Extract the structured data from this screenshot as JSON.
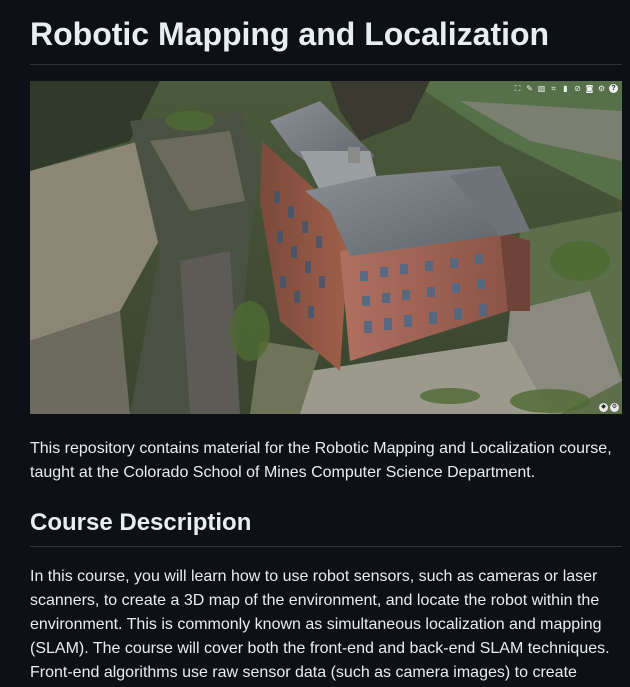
{
  "title": "Robotic Mapping and Localization",
  "viewer": {
    "toolbar_icons": [
      "expand-icon",
      "pencil-icon",
      "layers-icon",
      "grid-icon",
      "ruler-icon",
      "hide-icon",
      "camera-icon",
      "settings-icon",
      "help-icon"
    ],
    "help_label": "?",
    "bottom_icons": [
      "layers-icon",
      "settings-icon"
    ]
  },
  "intro": "This repository contains material for the Robotic Mapping and Localization course, taught at the Colorado School of Mines Computer Science Department.",
  "section": {
    "heading": "Course Description",
    "body": "In this course, you will learn how to use robot sensors, such as cameras or laser scanners, to create a 3D map of the environment, and locate the robot within the environment. This is commonly known as simultaneous localization and mapping (SLAM). The course will cover both the front-end and back-end SLAM techniques. Front-end algorithms use raw sensor data (such as camera images) to create"
  },
  "colors": {
    "background": "#0d1117",
    "text": "#e6edf3",
    "rule": "#30363d"
  }
}
